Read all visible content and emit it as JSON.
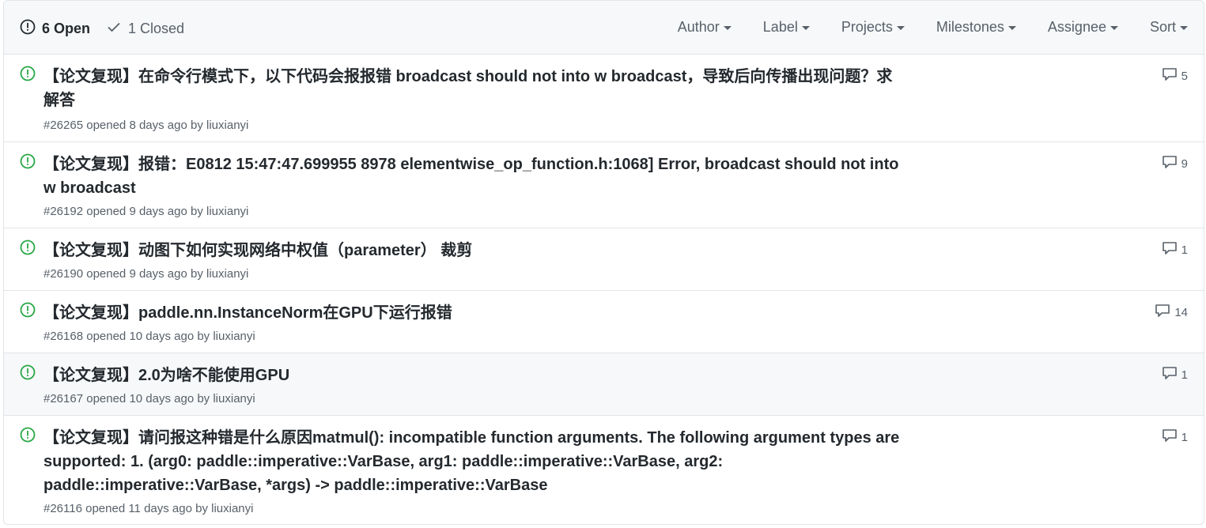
{
  "header": {
    "open_label": "6 Open",
    "closed_label": "1 Closed",
    "filters": [
      "Author",
      "Label",
      "Projects",
      "Milestones",
      "Assignee",
      "Sort"
    ]
  },
  "issues": [
    {
      "title": "【论文复现】在命令行模式下，以下代码会报报错 broadcast should not into w broadcast，导致后向传播出现问题？求解答",
      "meta": "#26265 opened 8 days ago by liuxianyi",
      "comments": "5"
    },
    {
      "title": "【论文复现】报错：E0812 15:47:47.699955 8978 elementwise_op_function.h:1068] Error, broadcast should not into w broadcast",
      "meta": "#26192 opened 9 days ago by liuxianyi",
      "comments": "9"
    },
    {
      "title": "【论文复现】动图下如何实现网络中权值（parameter） 裁剪",
      "meta": "#26190 opened 9 days ago by liuxianyi",
      "comments": "1"
    },
    {
      "title": "【论文复现】paddle.nn.InstanceNorm在GPU下运行报错",
      "meta": "#26168 opened 10 days ago by liuxianyi",
      "comments": "14"
    },
    {
      "title": "【论文复现】2.0为啥不能使用GPU",
      "meta": "#26167 opened 10 days ago by liuxianyi",
      "comments": "1"
    },
    {
      "title": "【论文复现】请问报这种错是什么原因matmul(): incompatible function arguments. The following argument types are supported: 1. (arg0: paddle::imperative::VarBase, arg1: paddle::imperative::VarBase, arg2: paddle::imperative::VarBase, *args) -> paddle::imperative::VarBase",
      "meta": "#26116 opened 11 days ago by liuxianyi",
      "comments": "1"
    }
  ],
  "colors": {
    "open_green": "#28a745",
    "muted": "#586069",
    "border": "#e1e4e8",
    "header_bg": "#f6f8fa"
  }
}
